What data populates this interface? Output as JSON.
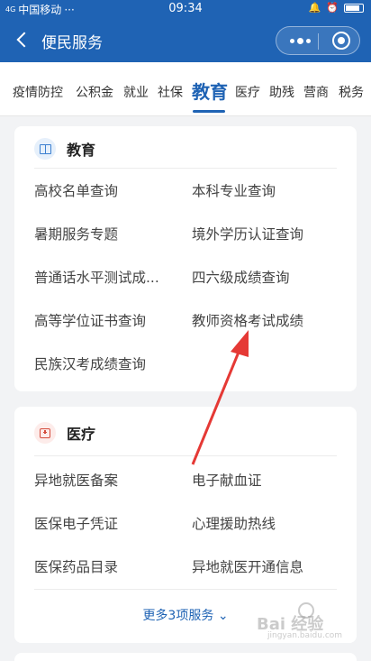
{
  "status_bar": {
    "signal": "4G",
    "carrier": "中国移动",
    "dots": "···",
    "time": "09:34"
  },
  "nav": {
    "title": "便民服务"
  },
  "tabs": [
    {
      "label": "疫情防控"
    },
    {
      "label": "公积金"
    },
    {
      "label": "就业"
    },
    {
      "label": "社保"
    },
    {
      "label": "教育"
    },
    {
      "label": "医疗"
    },
    {
      "label": "助残"
    },
    {
      "label": "营商"
    },
    {
      "label": "税务"
    }
  ],
  "active_tab": "教育",
  "education": {
    "title": "教育",
    "items": [
      "高校名单查询",
      "本科专业查询",
      "暑期服务专题",
      "境外学历认证查询",
      "普通话水平测试成...",
      "四六级成绩查询",
      "高等学位证书查询",
      "教师资格考试成绩",
      "民族汉考成绩查询"
    ]
  },
  "medical": {
    "title": "医疗",
    "items": [
      "异地就医备案",
      "电子献血证",
      "医保电子凭证",
      "心理援助热线",
      "医保药品目录",
      "异地就医开通信息"
    ],
    "more_label": "更多3项服务"
  },
  "colors": {
    "primary": "#1f63b4",
    "arrow": "#e53935",
    "education_icon_bg": "#e6f0fb",
    "medical_icon_bg": "#fdecea"
  },
  "watermark": {
    "text": "Bai 经验",
    "sub": "jingyan.baidu.com"
  }
}
